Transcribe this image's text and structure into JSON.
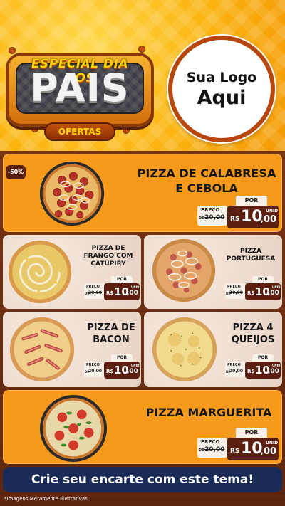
{
  "header": {
    "badge_top": "ESPECIAL DIA DOS",
    "badge_main": "PAIS",
    "badge_sub": "OFERTAS",
    "logo_line1": "Sua Logo",
    "logo_line2": "Aqui"
  },
  "discount_badge": "-50%",
  "labels": {
    "por": "POR",
    "preco": "PREÇO",
    "de": "DE",
    "rs": "R$",
    "unid": "UNID"
  },
  "products": [
    {
      "name_line1": "PIZZA DE CALABRESA",
      "name_line2": "E CEBOLA",
      "old_price": "20,00",
      "price_int": "10",
      "price_dec": ",00"
    },
    {
      "name_line1": "PIZZA DE",
      "name_line2": "FRANGO COM",
      "name_line3": "CATUPIRY",
      "old_price": "20,00",
      "price_int": "10",
      "price_dec": ",00"
    },
    {
      "name_line1": "PIZZA",
      "name_line2": "PORTUGUESA",
      "old_price": "20,00",
      "price_int": "10",
      "price_dec": ",00"
    },
    {
      "name_line1": "PIZZA DE",
      "name_line2": "BACON",
      "old_price": "20,00",
      "price_int": "10",
      "price_dec": ",00"
    },
    {
      "name_line1": "PIZZA 4",
      "name_line2": "QUEIJOS",
      "old_price": "20,00",
      "price_int": "10",
      "price_dec": ",00"
    },
    {
      "name_line1": "PIZZA MARGUERITA",
      "old_price": "20,00",
      "price_int": "10",
      "price_dec": ",00"
    }
  ],
  "cta": "Crie seu encarte com este tema!",
  "footnote": "*Imagens Meramente Ilustrativas",
  "colors": {
    "orange_card": "#f79a1b",
    "price_dark": "#5a1f10",
    "cta_navy": "#1a2b57",
    "header_yellow": "#fbb40f"
  }
}
